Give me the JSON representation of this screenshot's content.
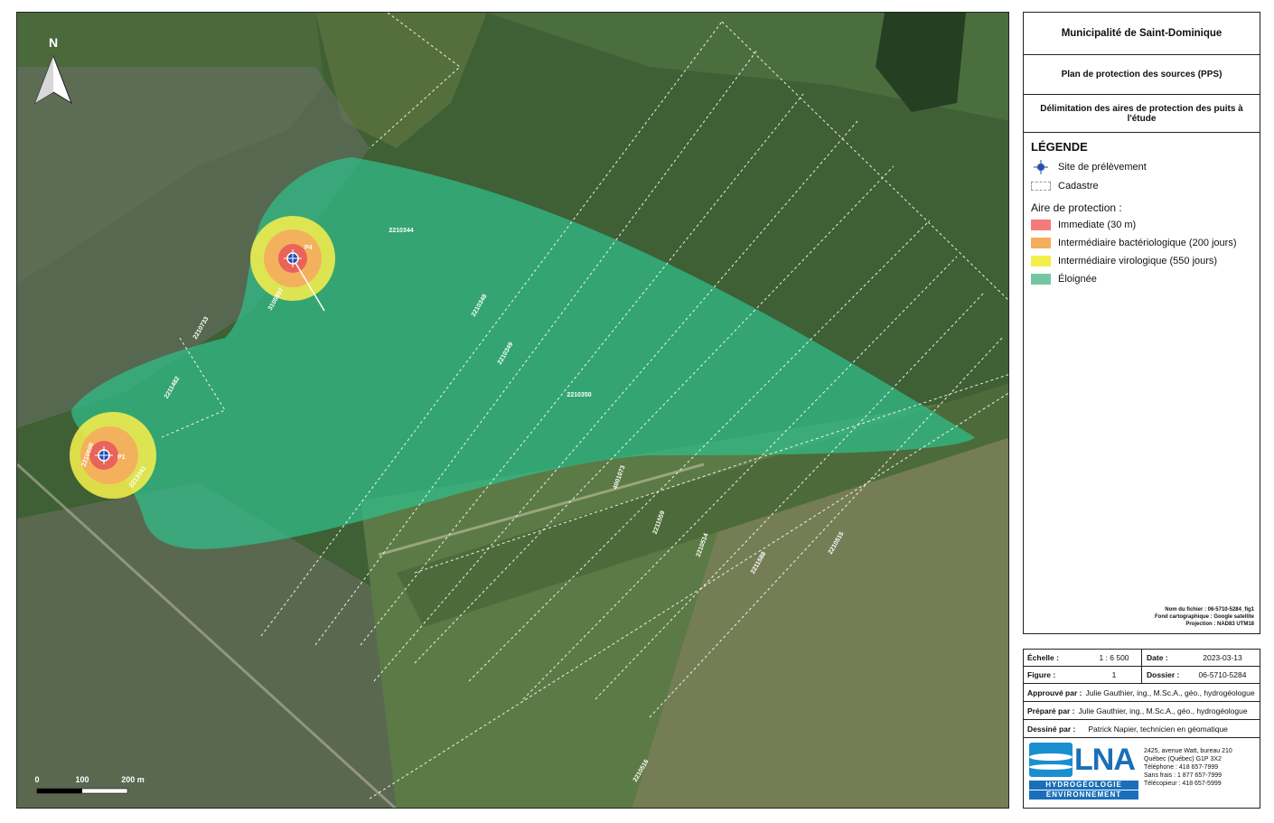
{
  "panel": {
    "municipality": "Municipalité de Saint-Dominique",
    "plan": "Plan de protection des sources (PPS)",
    "subtitle": "Délimitation des aires de protection des puits à l'étude"
  },
  "legend": {
    "title": "LÉGENDE",
    "site_label": "Site de prélèvement",
    "cadastre_label": "Cadastre",
    "protection_title": "Aire de protection :",
    "zones": [
      {
        "label": "Immediate (30 m)",
        "color": "#f47b7b"
      },
      {
        "label": "Intermédiaire bactériologique (200 jours)",
        "color": "#f5ad5e"
      },
      {
        "label": "Intermédiaire virologique (550 jours)",
        "color": "#f4ee4c"
      },
      {
        "label": "Éloignée",
        "color": "#74c6a3"
      }
    ]
  },
  "meta": {
    "file": "Nom du fichier : 06-5710-5284_fig1",
    "basemap": "Fond cartographique : Google satellite",
    "projection": "Projection : NAD83 UTM18"
  },
  "info": {
    "scale_label": "Échelle :",
    "scale_value": "1 : 6 500",
    "date_label": "Date :",
    "date_value": "2023-03-13",
    "figure_label": "Figure :",
    "figure_value": "1",
    "dossier_label": "Dossier :",
    "dossier_value": "06-5710-5284",
    "approved_label": "Approuvé par :",
    "approved_value": "Julie Gauthier, ing., M.Sc.A., géo., hydrogéologue",
    "prepared_label": "Préparé par :",
    "prepared_value": "Julie Gauthier, ing., M.Sc.A., géo., hydrogéologue",
    "drawn_label": "Dessiné par :",
    "drawn_value": "Patrick Napier, technicien en géomatique"
  },
  "company": {
    "logo_text": "LNA",
    "logo_sub1": "HYDROGÉOLOGIE",
    "logo_sub2": "ENVIRONNEMENT",
    "address1": "2425, avenue Watt, bureau 210",
    "address2": "Québec (Québec) G1P 3X2",
    "phone": "Téléphone : 418 657-7999",
    "tollfree": "Sans frais : 1 877 657-7999",
    "fax": "Télécopieur : 418 657-5999"
  },
  "map": {
    "north_label": "N",
    "scalebar": {
      "t0": "0",
      "t1": "100",
      "t2": "200 m"
    },
    "wells": [
      {
        "id": "P4"
      },
      {
        "id": "P1"
      }
    ],
    "lots": [
      {
        "text": "2210344"
      },
      {
        "text": "3105897"
      },
      {
        "text": "2210348"
      },
      {
        "text": "2210349"
      },
      {
        "text": "2210350"
      },
      {
        "text": "2210733"
      },
      {
        "text": "2211482"
      },
      {
        "text": "2210608"
      },
      {
        "text": "2213341"
      },
      {
        "text": "4001073"
      },
      {
        "text": "2211559"
      },
      {
        "text": "2210514"
      },
      {
        "text": "2211588"
      },
      {
        "text": "2210515"
      },
      {
        "text": "2210516"
      }
    ]
  }
}
